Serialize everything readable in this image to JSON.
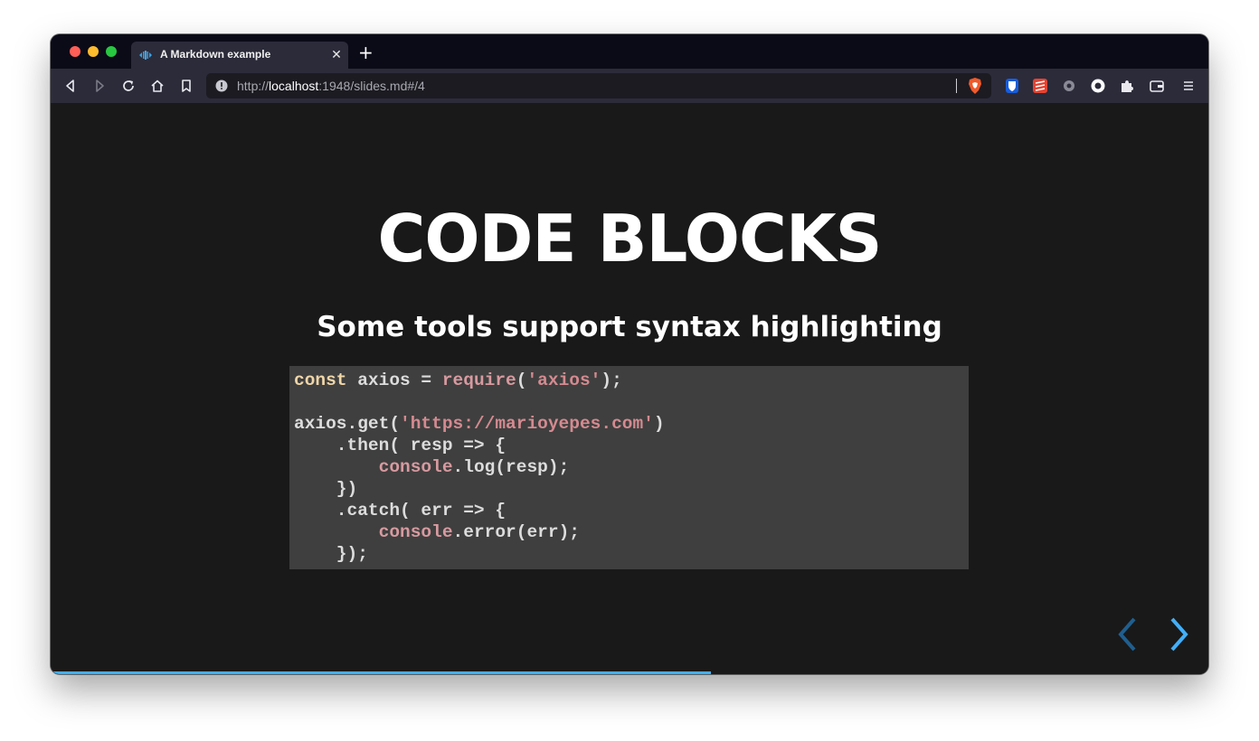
{
  "browser": {
    "tab": {
      "title": "A Markdown example",
      "favicon": "markdown-slides-icon",
      "close_glyph": "✕"
    },
    "new_tab_glyph": "+",
    "toolbar": {
      "back": "back-icon",
      "forward": "forward-icon",
      "reload": "reload-icon",
      "home": "home-icon",
      "bookmark": "bookmark-icon"
    },
    "url": {
      "scheme": "http://",
      "host": "localhost",
      "rest": ":1948/slides.md#/4"
    },
    "extensions": [
      "brave-shield-icon",
      "bitwarden-icon",
      "todoist-icon",
      "settings-gear-icon",
      "extension-icon-round",
      "puzzle-extensions-icon",
      "wallet-icon",
      "menu-icon"
    ]
  },
  "slide": {
    "title": "CODE BLOCKS",
    "subtitle": "Some tools support syntax highlighting",
    "code_lines": [
      [
        {
          "t": "const",
          "c": "kw"
        },
        {
          "t": " axios = ",
          "c": ""
        },
        {
          "t": "require",
          "c": "fn"
        },
        {
          "t": "(",
          "c": ""
        },
        {
          "t": "'axios'",
          "c": "str"
        },
        {
          "t": ");",
          "c": ""
        }
      ],
      [],
      [
        {
          "t": "axios.get(",
          "c": ""
        },
        {
          "t": "'https://marioyepes.com'",
          "c": "str"
        },
        {
          "t": ")",
          "c": ""
        }
      ],
      [
        {
          "t": "    .then( resp => {",
          "c": ""
        }
      ],
      [
        {
          "t": "        ",
          "c": ""
        },
        {
          "t": "console",
          "c": "fn"
        },
        {
          "t": ".log(resp);",
          "c": ""
        }
      ],
      [
        {
          "t": "    })",
          "c": ""
        }
      ],
      [
        {
          "t": "    .catch( err => {",
          "c": ""
        }
      ],
      [
        {
          "t": "        ",
          "c": ""
        },
        {
          "t": "console",
          "c": "fn"
        },
        {
          "t": ".error(err);",
          "c": ""
        }
      ],
      [
        {
          "t": "    });",
          "c": ""
        }
      ]
    ],
    "progress": 0.57,
    "accent_color": "#42affa"
  }
}
